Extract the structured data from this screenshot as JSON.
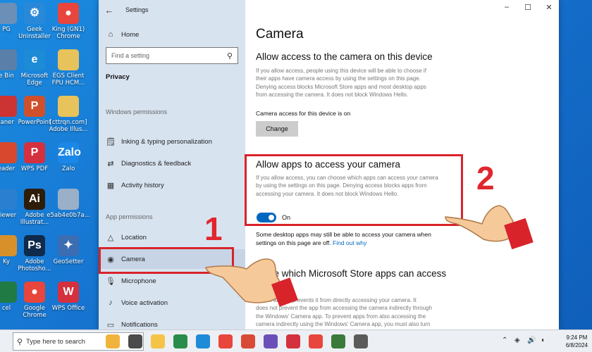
{
  "desktop": {
    "icons": [
      {
        "label": "PG",
        "color": "#6c8fb7",
        "glyph": ""
      },
      {
        "label": "Geek Uninstaller",
        "color": "#2a88d8",
        "glyph": "⚙"
      },
      {
        "label": "King (GN1) Chrome",
        "color": "#e8453c",
        "glyph": "●"
      },
      {
        "label": "e Bin",
        "color": "#5a7fa8",
        "glyph": ""
      },
      {
        "label": "Microsoft Edge",
        "color": "#1e8bd6",
        "glyph": "e"
      },
      {
        "label": "EGS Client FPU HCM...",
        "color": "#e8c25a",
        "glyph": ""
      },
      {
        "label": "laner",
        "color": "#cc3333",
        "glyph": ""
      },
      {
        "label": "PowerPoint",
        "color": "#d0502c",
        "glyph": "P"
      },
      {
        "label": "[cttrqn.com] Adobe Illus...",
        "color": "#e8c25a",
        "glyph": ""
      },
      {
        "label": "eader",
        "color": "#d7482e",
        "glyph": ""
      },
      {
        "label": "WPS PDF",
        "color": "#d5303e",
        "glyph": "P"
      },
      {
        "label": "Zalo",
        "color": "#1b87e6",
        "glyph": "Zalo"
      },
      {
        "label": "viewer",
        "color": "#2a7fd0",
        "glyph": ""
      },
      {
        "label": "Adobe Illustrat...",
        "color": "#2d1c08",
        "glyph": "Ai"
      },
      {
        "label": "e5ab4e0b7a...",
        "color": "#9ab0c8",
        "glyph": ""
      },
      {
        "label": "Ky",
        "color": "#d8912a",
        "glyph": ""
      },
      {
        "label": "Adobe Photosho...",
        "color": "#0f2a4a",
        "glyph": "Ps"
      },
      {
        "label": "GeoSetter",
        "color": "#3b6db3",
        "glyph": "✦"
      },
      {
        "label": "cel",
        "color": "#1f7a44",
        "glyph": ""
      },
      {
        "label": "Google Chrome",
        "color": "#e8453c",
        "glyph": "●"
      },
      {
        "label": "WPS Office",
        "color": "#d5303e",
        "glyph": "W"
      }
    ]
  },
  "window": {
    "title": "Settings",
    "back_icon": "←"
  },
  "sidebar": {
    "home": "Home",
    "search_placeholder": "Find a setting",
    "category": "Privacy",
    "windows_permissions_heading": "Windows permissions",
    "windows_items": [
      {
        "label": "Inking & typing personalization",
        "icon": "🗒"
      },
      {
        "label": "Diagnostics & feedback",
        "icon": "⇄"
      },
      {
        "label": "Activity history",
        "icon": "▦"
      }
    ],
    "app_permissions_heading": "App permissions",
    "app_items": [
      {
        "label": "Location",
        "icon": "△"
      },
      {
        "label": "Camera",
        "icon": "◉"
      },
      {
        "label": "Microphone",
        "icon": "🎙"
      },
      {
        "label": "Voice activation",
        "icon": "♪"
      },
      {
        "label": "Notifications",
        "icon": "▭"
      }
    ]
  },
  "content": {
    "title": "Camera",
    "device_heading": "Allow access to the camera on this device",
    "device_desc_lines": [
      "If you allow access, people using this device will be able to choose if",
      "their apps have camera access by using the settings on this page.",
      "Denying access blocks Microsoft Store apps and most desktop apps",
      "from accessing the camera. It does not block Windows Hello."
    ],
    "device_status": "Camera access for this device is on",
    "change_button": "Change",
    "apps_heading": "Allow apps to access your camera",
    "apps_desc_lines": [
      "If you allow access, you can choose which apps can access your camera",
      "by using the settings on this page. Denying access blocks apps from",
      "accessing your camera. It does not block Windows Hello."
    ],
    "toggle_state": "On",
    "note_line1": "Some desktop apps may still be able to access your camera when",
    "note_line2": "settings on this page are off.",
    "find_out_link": "Find out why",
    "store_heading_line1": "...ose which Microsoft Store apps can access",
    "store_heading_line2": "...ra",
    "store_desc_lines": [
      "Turn... an app prevents it from directly accessing your camera. It",
      "does not prevent the app from accessing the camera indirectly through",
      "the Windows' Camera app. To prevent apps from also accessing the",
      "camera indirectly using the Windows' Camera app, you must also turn"
    ]
  },
  "annotations": {
    "num1": "1",
    "num2": "2",
    "color": "#d8232a"
  },
  "taskbar": {
    "search_placeholder": "Type here to search",
    "time": "9:24 PM",
    "date": "6/8/2024",
    "apps": [
      "#f0b43c",
      "#4b4b4b",
      "#f5c346",
      "#2a8c4a",
      "#1e8bd6",
      "#e8453c",
      "#d94a36",
      "#6b4fb8",
      "#d5303e",
      "#e8453c",
      "#3a7a3a",
      "#5a5a5a"
    ]
  }
}
